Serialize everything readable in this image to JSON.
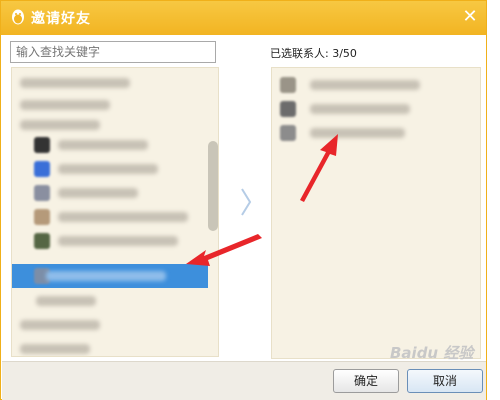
{
  "dialog": {
    "title": "邀请好友",
    "close_glyph": "✕"
  },
  "search": {
    "placeholder": "输入查找关键字"
  },
  "selected": {
    "label": "已选联系人: 3/50"
  },
  "buttons": {
    "ok": "确定",
    "cancel": "取消"
  },
  "watermark": "Baidu 经验",
  "colors": {
    "title_bar": "#f2b422",
    "selection": "#3d8fdc",
    "annotation_arrow": "#e8262a",
    "panel_bg": "#f7f2e4"
  },
  "icons": {
    "title": "qq-penguin-icon",
    "expand": "chevron-right-icon"
  }
}
